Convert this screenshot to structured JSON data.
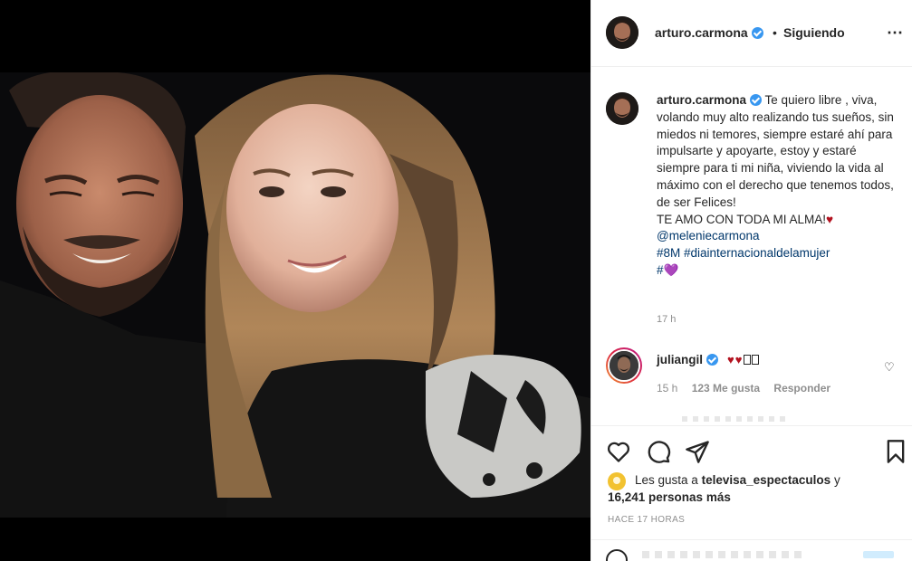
{
  "colors": {
    "accent_blue": "#3897f0",
    "link_blue": "#00376b",
    "heart_red": "#b3121f",
    "purple_heart": "#8b2fc9",
    "muted_gray": "#8e8e8e"
  },
  "header": {
    "username": "arturo.carmona",
    "dot": "•",
    "follow_status": "Siguiendo",
    "more_icon": "⋯"
  },
  "caption": {
    "username": "arturo.carmona",
    "text": "Te quiero libre , viva, volando muy alto realizando tus sueños, sin miedos ni temores, siempre estaré ahí para impulsarte y apoyarte, estoy y estaré siempre para ti mi niña, viviendo la vida al máximo con el derecho que tenemos todos, de ser Felices!",
    "love_line": "TE AMO CON TODA MI ALMA!",
    "love_emoji": "♥",
    "mention": "@meleniecarmona",
    "hashtags": "#8M #diainternacionaldelamujer",
    "last_tag": "#",
    "last_emoji": "💜",
    "time": "17 h"
  },
  "comment": {
    "username": "juliangil",
    "text": "♥♥",
    "time": "15 h",
    "likes": "123 Me gusta",
    "reply": "Responder",
    "like_icon": "heart-outline-icon"
  },
  "actions": {
    "icons": [
      "heart-outline-icon",
      "comment-bubble-icon",
      "send-icon",
      "bookmark-icon"
    ]
  },
  "likes": {
    "prefix": "Les gusta a",
    "first_user": "televisa_espectaculos",
    "connector": "y",
    "count": "16,241 personas más"
  },
  "post_date": "HACE 17 HORAS"
}
